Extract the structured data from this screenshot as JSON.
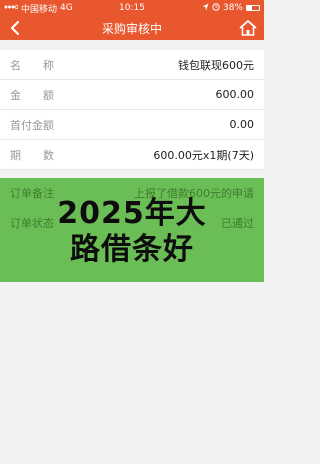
{
  "status_bar": {
    "carrier": "中国移动",
    "network": "4G",
    "time": "10:15",
    "battery": "38%",
    "battery_level": 0.38
  },
  "nav": {
    "title": "采购审核中"
  },
  "details": [
    {
      "label": "名称",
      "value": "钱包联现600元"
    },
    {
      "label": "金额",
      "value": "600.00"
    },
    {
      "label": "首付金额",
      "value": "0.00"
    },
    {
      "label": "期数",
      "value": "600.00元x1期(7天)"
    }
  ],
  "status_rows": [
    {
      "label": "订单备注",
      "value": "上报了借款600元的申请"
    },
    {
      "label": "订单状态",
      "value": "已通过"
    }
  ],
  "banner": {
    "line1": "2025年大",
    "line2": "路借条好"
  },
  "colors": {
    "brand": "#e8572e",
    "overlay": "#5fba48"
  }
}
